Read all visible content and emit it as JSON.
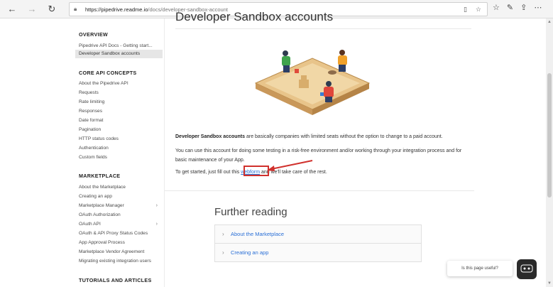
{
  "browser": {
    "url_host": "https://pipedrive.readme.io",
    "url_path": "/docs/developer-sandbox-account"
  },
  "sidebar": {
    "sections": [
      {
        "heading": "OVERVIEW",
        "items": [
          "Pipedrive API Docs - Getting start...",
          "Developer Sandbox accounts"
        ]
      },
      {
        "heading": "CORE API CONCEPTS",
        "items": [
          "About the Pipedrive API",
          "Requests",
          "Rate limiting",
          "Responses",
          "Date format",
          "Pagination",
          "HTTP status codes",
          "Authentication",
          "Custom fields"
        ]
      },
      {
        "heading": "MARKETPLACE",
        "items": [
          "About the Marketplace",
          "Creating an app",
          "Marketplace Manager",
          "OAuth Authorization",
          "OAuth API",
          "OAuth & API Proxy Status Codes",
          "App Approval Process",
          "Marketplace Vendor Agreement",
          "Migrating existing integration users"
        ]
      },
      {
        "heading": "TUTORIALS AND ARTICLES",
        "items": []
      }
    ]
  },
  "main": {
    "title": "Developer Sandbox accounts",
    "para1_bold": "Developer Sandbox accounts",
    "para1_rest": " are basically companies with limited seats without the option to change to a paid account.",
    "para2": "You can use this account for doing some testing in a risk-free environment and/or working through your integration process and for basic maintenance of your App.",
    "para3_before": "To get started, just fill out this ",
    "para3_link": "webform",
    "para3_after": " and we'll take care of the rest.",
    "further_title": "Further reading",
    "further_items": [
      "About the Marketplace",
      "Creating an app"
    ]
  },
  "feedback": {
    "label": "Is this page useful?"
  },
  "colors": {
    "link": "#2a6fd6",
    "highlight": "#d0312d"
  }
}
